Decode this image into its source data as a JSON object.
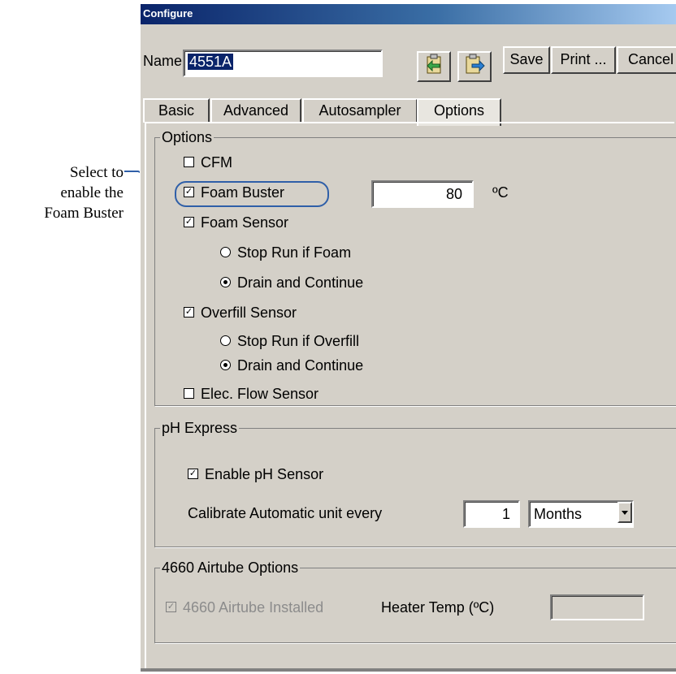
{
  "callout": {
    "line1": "Select to",
    "line2": "enable the",
    "line3": "Foam Buster"
  },
  "window": {
    "title": "Configure"
  },
  "header": {
    "name_label": "Name",
    "name_value": "4551A",
    "buttons": {
      "import_icon": "import-document-icon",
      "export_icon": "export-document-icon",
      "save": "Save",
      "print": "Print ...",
      "cancel": "Cancel"
    }
  },
  "tabs": [
    {
      "label": "Basic"
    },
    {
      "label": "Advanced"
    },
    {
      "label": "Autosampler"
    },
    {
      "label": "Options",
      "active": true
    }
  ],
  "options": {
    "legend": "Options",
    "cfm": {
      "label": "CFM",
      "checked": false
    },
    "foam_buster": {
      "label": "Foam Buster",
      "checked": true,
      "value": "80",
      "unit": "ºC"
    },
    "foam_sensor": {
      "label": "Foam Sensor",
      "checked": true,
      "radios": [
        {
          "label": "Stop Run if Foam",
          "selected": false
        },
        {
          "label": "Drain and Continue",
          "selected": true
        }
      ]
    },
    "overfill_sensor": {
      "label": "Overfill Sensor",
      "checked": true,
      "radios": [
        {
          "label": "Stop Run if Overfill",
          "selected": false
        },
        {
          "label": "Drain and Continue",
          "selected": true
        }
      ]
    },
    "elec_flow": {
      "label": "Elec. Flow Sensor",
      "checked": false
    }
  },
  "ph_express": {
    "legend": "pH Express",
    "enable": {
      "label": "Enable pH Sensor",
      "checked": true
    },
    "calibrate_label": "Calibrate Automatic unit every",
    "calibrate_value": "1",
    "calibrate_unit": "Months"
  },
  "airtube": {
    "legend": "4660 Airtube Options",
    "installed": {
      "label": "4660 Airtube Installed",
      "checked": true,
      "disabled": true
    },
    "heater_label": "Heater Temp (ºC)",
    "heater_value": ""
  },
  "colors": {
    "highlight": "#2f5fa8",
    "title_bar": "#0a246a",
    "window_bg": "#d4d0c8"
  }
}
